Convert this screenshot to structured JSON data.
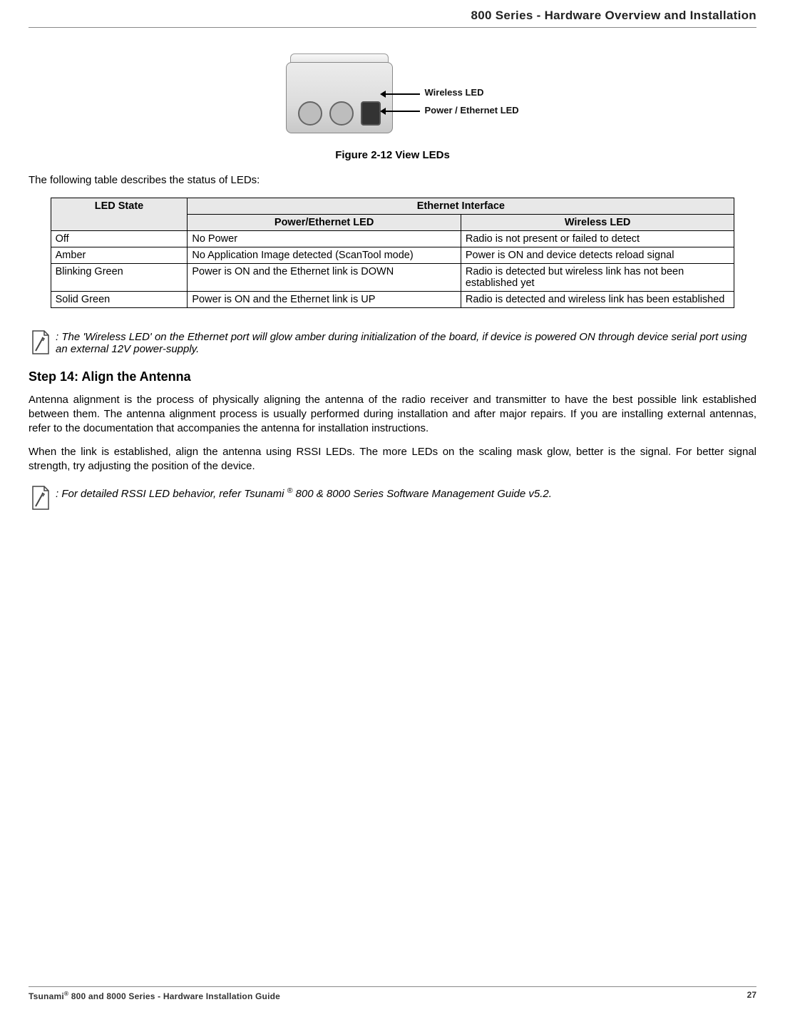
{
  "header": {
    "title": "800 Series - Hardware Overview and Installation"
  },
  "figure": {
    "labels": {
      "wireless": "Wireless LED",
      "power_eth": "Power / Ethernet LED"
    },
    "caption": "Figure 2-12 View LEDs"
  },
  "intro": "The following table describes the status of LEDs:",
  "table": {
    "headers": {
      "led_state": "LED State",
      "eth_interface": "Ethernet Interface",
      "power_eth_led": "Power/Ethernet LED",
      "wireless_led": "Wireless LED"
    },
    "rows": [
      {
        "state": "Off",
        "pel": "No Power",
        "wl": "Radio is not present or failed to detect"
      },
      {
        "state": "Amber",
        "pel": "No Application Image detected (ScanTool mode)",
        "wl": "Power is ON and device detects reload signal"
      },
      {
        "state": "Blinking Green",
        "pel": "Power is ON and the Ethernet link is DOWN",
        "wl": "Radio is detected but wireless link has not been established yet"
      },
      {
        "state": "Solid Green",
        "pel": "Power is ON and the Ethernet link is UP",
        "wl": "Radio is detected and wireless link has been established"
      }
    ]
  },
  "note1": ": The 'Wireless LED' on the Ethernet port will glow amber during initialization of the board, if device is powered ON through device serial port using an external 12V power-supply.",
  "step14": {
    "heading": "Step 14: Align the Antenna",
    "p1": "Antenna alignment is the process of physically aligning the antenna of the radio receiver and transmitter to have the best possible link established between them. The antenna alignment process is usually performed during installation and after major repairs. If you are installing external antennas, refer to the documentation that accompanies the antenna for installation instructions.",
    "p2": "When the link is established, align the antenna using RSSI LEDs. The more LEDs on the scaling mask glow, better is the signal. For better signal strength, try adjusting the position of the device."
  },
  "note2_pre": ": For detailed RSSI LED behavior, refer Tsunami ",
  "note2_post": " 800 & 8000 Series Software Management Guide v5.2.",
  "footer": {
    "title_pre": "Tsunami",
    "title_post": " 800 and 8000 Series - Hardware Installation Guide",
    "page": "27"
  }
}
